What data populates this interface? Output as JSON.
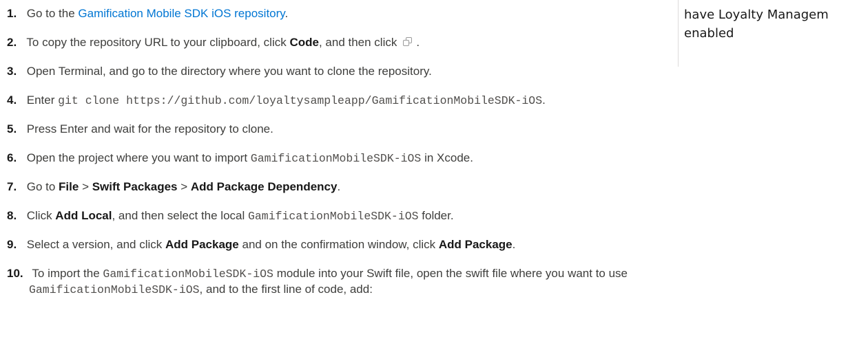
{
  "steps": [
    {
      "number": "1.",
      "text_before": "Go to the ",
      "link": "Gamification Mobile SDK iOS repository",
      "text_after": "."
    },
    {
      "number": "2.",
      "text_before": "To copy the repository URL to your clipboard, click ",
      "bold": "Code",
      "text_mid": ", and then click",
      "icon": "copy-icon",
      "text_after": "."
    },
    {
      "number": "3.",
      "text": "Open Terminal, and go to the directory where you want to clone the repository."
    },
    {
      "number": "4.",
      "text_before": "Enter ",
      "code": "git clone https://github.com/loyaltysampleapp/GamificationMobileSDK-iOS",
      "text_after": "."
    },
    {
      "number": "5.",
      "text": "Press Enter and wait for the repository to clone."
    },
    {
      "number": "6.",
      "text_before": "Open the project where you want to import ",
      "code": "GamificationMobileSDK-iOS",
      "text_after": " in Xcode."
    },
    {
      "number": "7.",
      "text_before": "Go to ",
      "menu_1": "File",
      "sep_1": " > ",
      "menu_2": "Swift Packages",
      "sep_2": " > ",
      "menu_3": "Add Package Dependency",
      "text_after": "."
    },
    {
      "number": "8.",
      "text_before": "Click ",
      "bold": "Add Local",
      "text_mid": ", and then select the local ",
      "code": "GamificationMobileSDK-iOS",
      "text_after": " folder."
    },
    {
      "number": "9.",
      "text_before": "Select a version, and click ",
      "bold_1": "Add Package",
      "text_mid": " and on the confirmation window, click ",
      "bold_2": "Add Package",
      "text_after": "."
    },
    {
      "number": "10.",
      "text_before": "To import the ",
      "code_1": "GamificationMobileSDK-iOS",
      "text_mid": " module into your Swift file, open the swift file where you want to use",
      "code_2": "GamificationMobileSDK-iOS",
      "text_after": ", and to the first line of code, add:"
    }
  ],
  "sidebar": {
    "note": "have Loyalty Managem\nenabled"
  }
}
